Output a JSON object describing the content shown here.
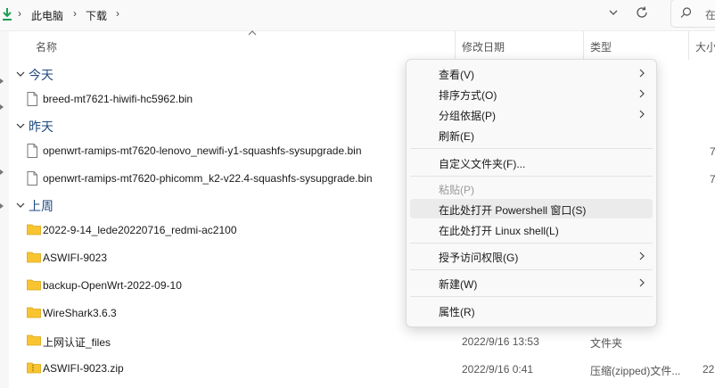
{
  "address_bar": {
    "crumbs": [
      "此电脑",
      "下载"
    ],
    "search_placeholder": "在"
  },
  "columns": {
    "name": "名称",
    "modified": "修改日期",
    "type": "类型",
    "size": "大小"
  },
  "groups": {
    "today": {
      "label": "今天",
      "files": [
        {
          "name": "breed-mt7621-hiwifi-hc5962.bin"
        }
      ]
    },
    "yesterday": {
      "label": "昨天",
      "files": [
        {
          "name": "openwrt-ramips-mt7620-lenovo_newifi-y1-squashfs-sysupgrade.bin",
          "size": "7"
        },
        {
          "name": "openwrt-ramips-mt7620-phicomm_k2-v22.4-squashfs-sysupgrade.bin",
          "size": "7"
        }
      ]
    },
    "last_week": {
      "label": "上周",
      "files": [
        {
          "name": "2022-9-14_lede20220716_redmi-ac2100",
          "kind": "folder"
        },
        {
          "name": "ASWIFI-9023",
          "kind": "folder"
        },
        {
          "name": "backup-OpenWrt-2022-09-10",
          "kind": "folder"
        },
        {
          "name": "WireShark3.6.3",
          "kind": "folder"
        },
        {
          "name": "上网认证_files",
          "kind": "folder",
          "date": "2022/9/16 13:53",
          "type": "文件夹"
        },
        {
          "name": "ASWIFI-9023.zip",
          "kind": "zip",
          "date": "2022/9/16 0:41",
          "type": "压缩(zipped)文件...",
          "size": "22"
        }
      ]
    }
  },
  "context_menu": {
    "items": [
      {
        "label": "查看(V)",
        "submenu": true
      },
      {
        "label": "排序方式(O)",
        "submenu": true
      },
      {
        "label": "分组依据(P)",
        "submenu": true
      },
      {
        "label": "刷新(E)"
      },
      {
        "label": "自定义文件夹(F)..."
      },
      {
        "label": "粘贴(P)",
        "disabled": true
      },
      {
        "label": "在此处打开 Powershell 窗口(S)",
        "highlighted": true
      },
      {
        "label": "在此处打开 Linux shell(L)"
      },
      {
        "label": "授予访问权限(G)",
        "submenu": true
      },
      {
        "label": "新建(W)",
        "submenu": true
      },
      {
        "label": "属性(R)"
      }
    ]
  },
  "icons": {
    "download": "download-arrow-icon",
    "folder_color": "#f8c531",
    "accent": "#1f4a7f"
  }
}
